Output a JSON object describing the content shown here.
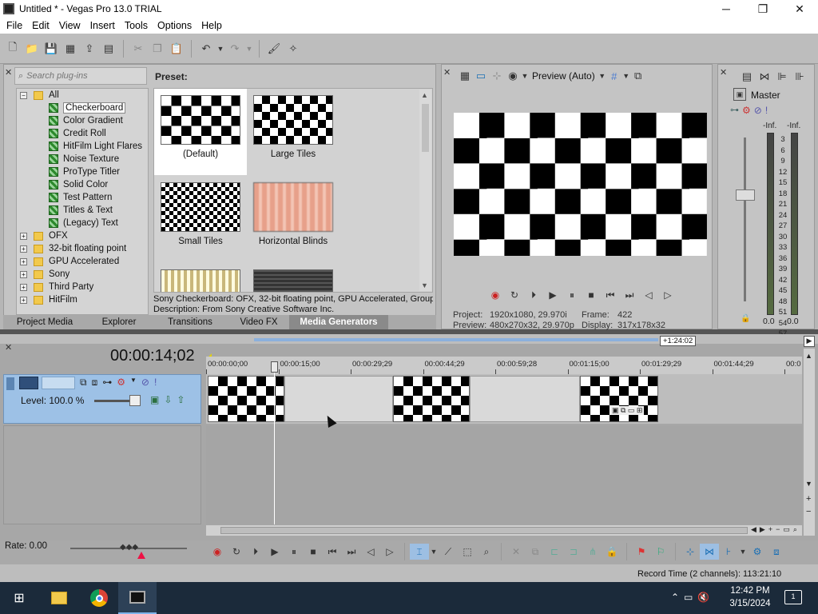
{
  "window": {
    "title": "Untitled * - Vegas Pro 13.0 TRIAL",
    "minimize": "─",
    "maximize": "❐",
    "close": "✕"
  },
  "menu": [
    "File",
    "Edit",
    "View",
    "Insert",
    "Tools",
    "Options",
    "Help"
  ],
  "toolbar_icons": [
    "new-icon",
    "open-icon",
    "save-icon",
    "save-as-icon",
    "render-icon",
    "properties-icon",
    "cut-icon",
    "copy-icon",
    "paste-icon",
    "undo-icon",
    "redo-icon",
    "paint-icon",
    "pointer-icon"
  ],
  "media_generators": {
    "search_placeholder": "Search plug-ins",
    "preset_label": "Preset:",
    "tree": [
      {
        "label": "All",
        "type": "folder",
        "level": 0,
        "expanded": true
      },
      {
        "label": "Checkerboard",
        "type": "gen",
        "level": 1,
        "selected": true
      },
      {
        "label": "Color Gradient",
        "type": "gen",
        "level": 1
      },
      {
        "label": "Credit Roll",
        "type": "gen",
        "level": 1
      },
      {
        "label": "HitFilm Light Flares",
        "type": "gen",
        "level": 1
      },
      {
        "label": "Noise Texture",
        "type": "gen",
        "level": 1
      },
      {
        "label": "ProType Titler",
        "type": "gen",
        "level": 1
      },
      {
        "label": "Solid Color",
        "type": "gen",
        "level": 1
      },
      {
        "label": "Test Pattern",
        "type": "gen",
        "level": 1
      },
      {
        "label": "Titles & Text",
        "type": "gen",
        "level": 1
      },
      {
        "label": "(Legacy) Text",
        "type": "gen",
        "level": 1
      },
      {
        "label": "OFX",
        "type": "folder",
        "level": 0
      },
      {
        "label": "32-bit floating point",
        "type": "folder",
        "level": 0
      },
      {
        "label": "GPU Accelerated",
        "type": "folder",
        "level": 0
      },
      {
        "label": "Sony",
        "type": "folder",
        "level": 0
      },
      {
        "label": "Third Party",
        "type": "folder",
        "level": 0
      },
      {
        "label": "HitFilm",
        "type": "folder",
        "level": 0
      }
    ],
    "presets": [
      {
        "name": "(Default)",
        "style": "checker-l",
        "selected": true
      },
      {
        "name": "Large Tiles",
        "style": "checker-m"
      },
      {
        "name": "Small Tiles",
        "style": "checker-s"
      },
      {
        "name": "Horizontal Blinds",
        "style": "blinds"
      },
      {
        "name": "",
        "style": "stripes-v"
      },
      {
        "name": "",
        "style": "dark-tex"
      }
    ],
    "description_line1": "Sony Checkerboard: OFX, 32-bit floating point, GPU Accelerated, Groupi",
    "description_line2": "Description: From Sony Creative Software Inc."
  },
  "tabs": [
    {
      "label": "Project Media",
      "active": false
    },
    {
      "label": "Explorer",
      "active": false
    },
    {
      "label": "Transitions",
      "active": false
    },
    {
      "label": "Video FX",
      "active": false
    },
    {
      "label": "Media Generators",
      "active": true
    }
  ],
  "preview": {
    "quality": "Preview (Auto)",
    "project_label": "Project:",
    "project_value": "1920x1080, 29.970i",
    "frame_label": "Frame:",
    "frame_value": "422",
    "preview_label": "Preview:",
    "preview_value": "480x270x32, 29.970p",
    "display_label": "Display:",
    "display_value": "317x178x32"
  },
  "master": {
    "title": "Master",
    "inf_left": "-Inf.",
    "inf_right": "-Inf.",
    "scale": [
      "3",
      "6",
      "9",
      "12",
      "15",
      "18",
      "21",
      "24",
      "27",
      "30",
      "33",
      "36",
      "39",
      "42",
      "45",
      "48",
      "51",
      "54",
      "57"
    ],
    "bottom_left": "0.0",
    "bottom_right": "0.0",
    "fader_level": 0.35
  },
  "timeline": {
    "timecode": "00:00:14;02",
    "duration_badge": "+1:24:02",
    "ruler_ticks": [
      "00:00:00;00",
      "00:00:15;00",
      "00:00:29;29",
      "00:00:44;29",
      "00:00:59;28",
      "00:01:15;00",
      "00:01:29;29",
      "00:01:44;29",
      "00:0"
    ],
    "track_level": "Level: 100.0 %",
    "rate": "Rate: 0.00"
  },
  "status": {
    "record_time": "Record Time (2 channels): 113:21:10"
  },
  "taskbar": {
    "time": "12:42 PM",
    "date": "3/15/2024",
    "notif": "1"
  }
}
